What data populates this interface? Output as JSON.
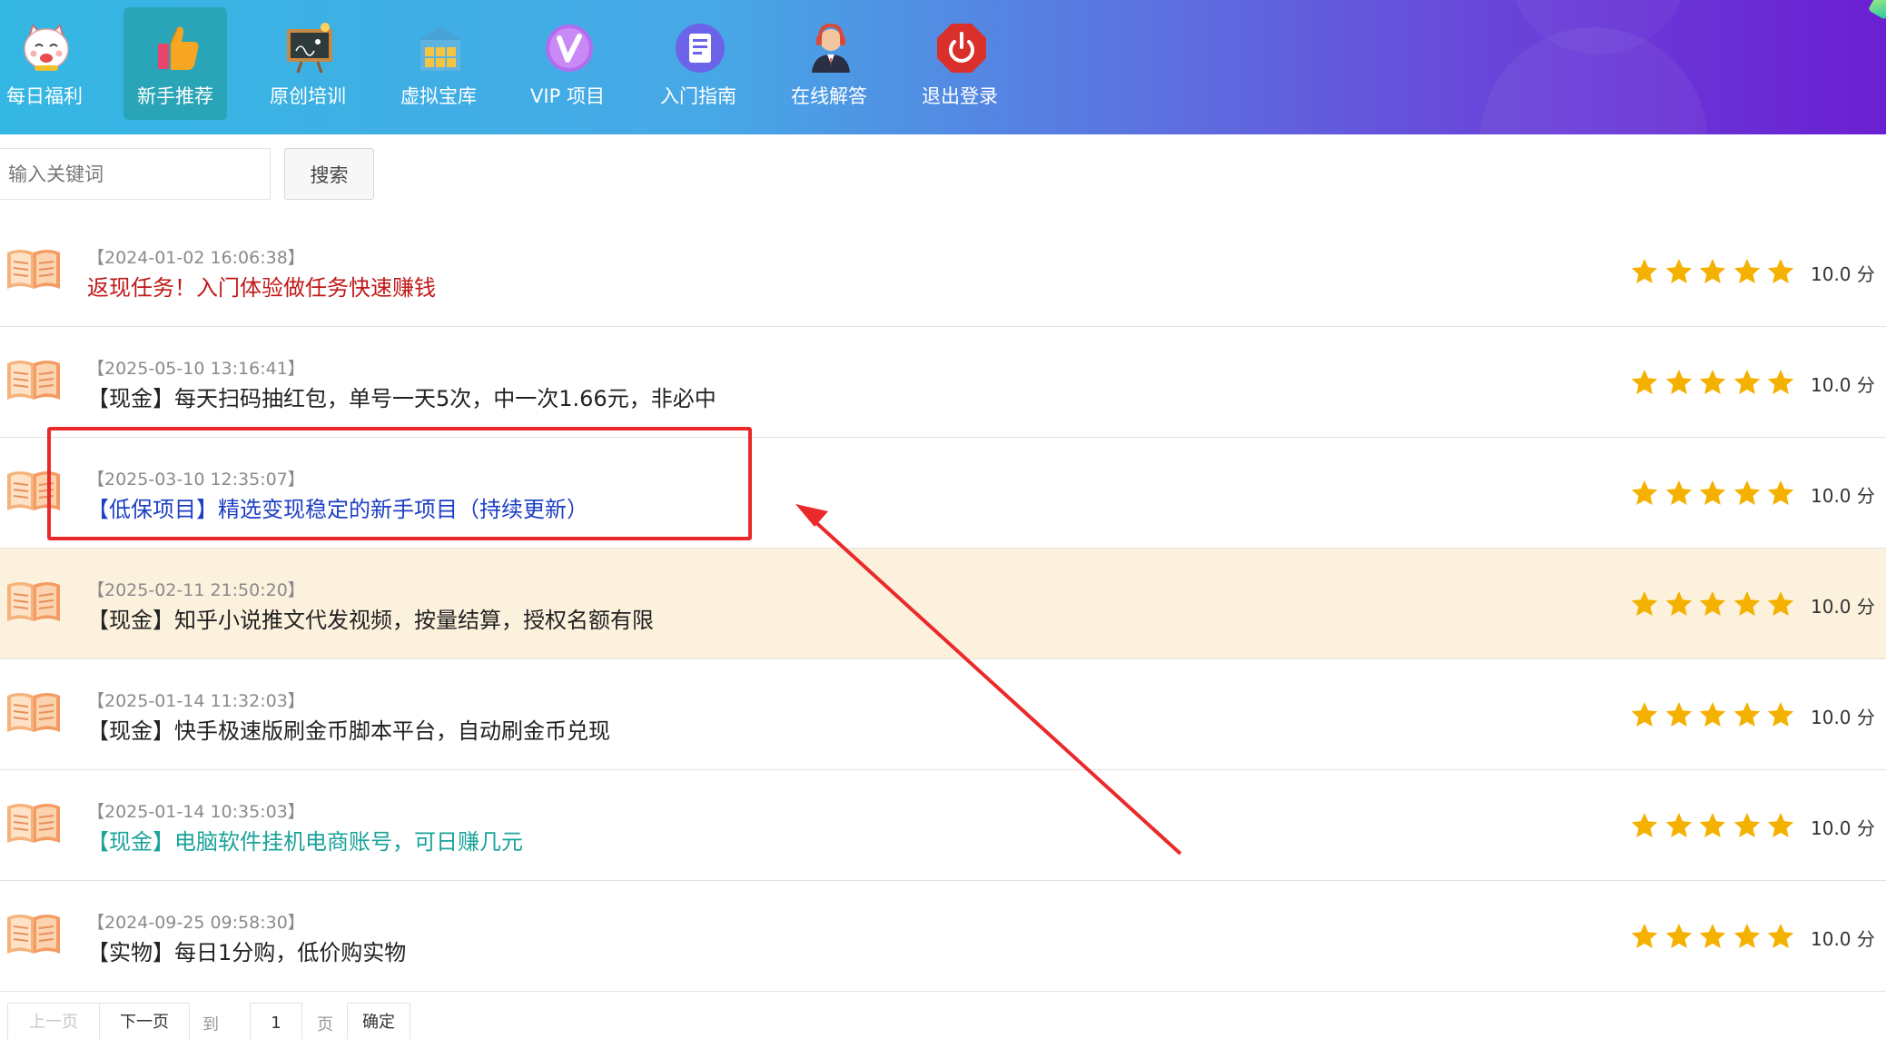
{
  "nav": {
    "items": [
      {
        "label": "每日福利",
        "icon": "lucky-cat-icon"
      },
      {
        "label": "新手推荐",
        "icon": "thumbs-up-icon"
      },
      {
        "label": "原创培训",
        "icon": "blackboard-icon"
      },
      {
        "label": "虚拟宝库",
        "icon": "warehouse-icon"
      },
      {
        "label": "VIP 项目",
        "icon": "vip-icon"
      },
      {
        "label": "入门指南",
        "icon": "document-icon"
      },
      {
        "label": "在线解答",
        "icon": "support-agent-icon"
      },
      {
        "label": "退出登录",
        "icon": "power-icon"
      }
    ],
    "active_index": 1
  },
  "search": {
    "placeholder": "输入关键词",
    "value": "",
    "button_label": "搜索"
  },
  "list": {
    "items": [
      {
        "date": "【2024-01-02 16:06:38】",
        "title": "返现任务！入门体验做任务快速赚钱",
        "title_color": "#c01818",
        "rating": 5,
        "score": "10.0 分"
      },
      {
        "date": "【2025-05-10 13:16:41】",
        "title": "【现金】每天扫码抽红包，单号一天5次，中一次1.66元，非必中",
        "title_color": "#222222",
        "rating": 5,
        "score": "10.0 分"
      },
      {
        "date": "【2025-03-10 12:35:07】",
        "title": "【低保项目】精选变现稳定的新手项目（持续更新）",
        "title_color": "#1d3fc4",
        "rating": 5,
        "score": "10.0 分"
      },
      {
        "date": "【2025-02-11 21:50:20】",
        "title": "【现金】知乎小说推文代发视频，按量结算，授权名额有限",
        "title_color": "#222222",
        "rating": 5,
        "score": "10.0 分"
      },
      {
        "date": "【2025-01-14 11:32:03】",
        "title": "【现金】快手极速版刷金币脚本平台，自动刷金币兑现",
        "title_color": "#222222",
        "rating": 5,
        "score": "10.0 分"
      },
      {
        "date": "【2025-01-14 10:35:03】",
        "title": "【现金】电脑软件挂机电商账号，可日赚几元",
        "title_color": "#1aa39a",
        "rating": 5,
        "score": "10.0 分"
      },
      {
        "date": "【2024-09-25 09:58:30】",
        "title": "【实物】每日1分购，低价购实物",
        "title_color": "#222222",
        "rating": 5,
        "score": "10.0 分"
      }
    ],
    "highlighted_index": 3
  },
  "pagination": {
    "prev_label": "上一页",
    "next_label": "下一页",
    "goto_label": "到第",
    "page_value": "1",
    "page_suffix": "页",
    "confirm_label": "确定"
  },
  "colors": {
    "header_start": "#34b7e3",
    "header_end": "#6b1fd2",
    "active_nav": "#2aa5b8",
    "star": "#f5b100",
    "highlight_row": "#fcf1dd",
    "annotation": "#ea2a2a"
  }
}
